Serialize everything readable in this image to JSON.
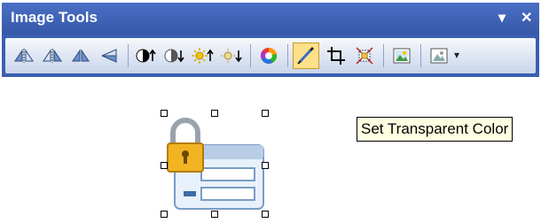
{
  "toolbar": {
    "title": "Image Tools",
    "dropdown_glyph": "▾",
    "close_glyph": "✕",
    "tools": [
      {
        "name": "flip-horizontal-icon"
      },
      {
        "name": "flip-horizontal-alt-icon"
      },
      {
        "name": "flip-vertical-icon"
      },
      {
        "name": "rotate-icon"
      },
      {
        "name": "contrast-up-icon"
      },
      {
        "name": "contrast-down-icon"
      },
      {
        "name": "brightness-up-icon"
      },
      {
        "name": "brightness-down-icon"
      },
      {
        "name": "color-wheel-icon"
      },
      {
        "name": "set-transparent-color-icon",
        "active": true
      },
      {
        "name": "crop-icon"
      },
      {
        "name": "resize-icon"
      },
      {
        "name": "insert-picture-icon"
      },
      {
        "name": "picture-options-icon"
      }
    ]
  },
  "tooltip": {
    "text": "Set Transparent Color"
  }
}
